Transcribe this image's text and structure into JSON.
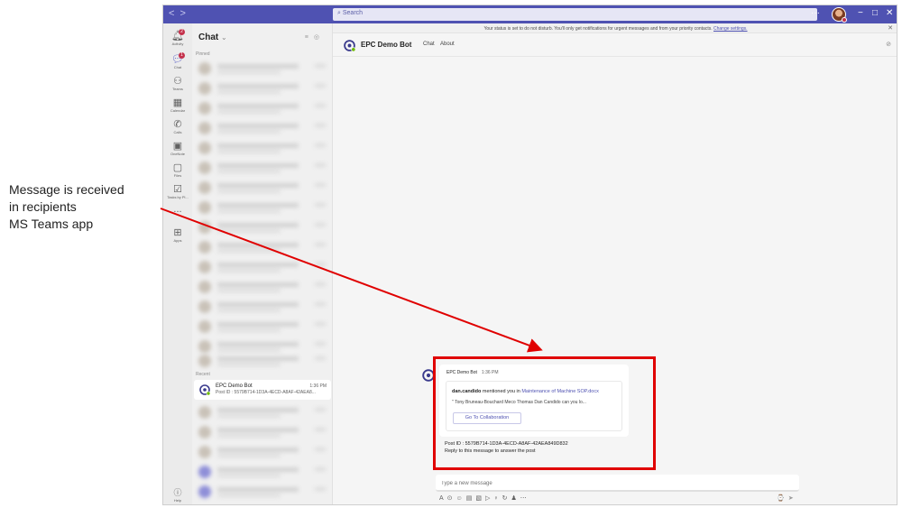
{
  "annotation": {
    "lines": [
      "Message is received",
      "in recipients",
      "MS Teams app"
    ],
    "color": "#e00000"
  },
  "titlebar": {
    "search_placeholder": "Search",
    "nav_back": "<",
    "nav_forward": ">",
    "more": "···",
    "minimize": "−",
    "maximize": "□",
    "close": "✕"
  },
  "rail": {
    "items": [
      {
        "label": "Activity",
        "icon": "bell-icon",
        "badge": "2"
      },
      {
        "label": "Chat",
        "icon": "chat-icon",
        "badge": "1"
      },
      {
        "label": "Teams",
        "icon": "teams-icon"
      },
      {
        "label": "Calendar",
        "icon": "calendar-icon"
      },
      {
        "label": "Calls",
        "icon": "phone-icon"
      },
      {
        "label": "OneNote",
        "icon": "onenote-icon"
      },
      {
        "label": "Files",
        "icon": "file-icon"
      },
      {
        "label": "Tasks by Pl...",
        "icon": "tasks-icon"
      },
      {
        "label": "...",
        "icon": "more-icon"
      },
      {
        "label": "Apps",
        "icon": "apps-icon"
      }
    ],
    "help_label": "Help"
  },
  "chatlist": {
    "title": "Chat",
    "pinned_label": "Pinned",
    "recent_label": "Recent",
    "bot_item": {
      "name": "EPC Demo Bot",
      "preview": "Post ID : 5579B714-1D3A-4ECD-A8AF-42AEA8...",
      "time": "1:36 PM"
    }
  },
  "main": {
    "status_banner": "Your status is set to do not disturb. You'll only get notifications for urgent messages and from your priority contacts.",
    "status_link": "Change settings.",
    "header_title": "EPC Demo Bot",
    "tab_chat": "Chat",
    "tab_about": "About"
  },
  "message": {
    "sender": "EPC Demo Bot",
    "time": "1:36 PM",
    "mention_user": "dan.candido",
    "mention_text": "mentioned you in",
    "doc_link": "Maintenance of Machine SOP.docx",
    "quote": "\" Tony Bruneau-Bouchard Meco Thomas Dan Candido  can you lo...",
    "button_label": "Go To Collaboration",
    "post_id": "Post ID : 5579B714-1D3A-4ECD-A8AF-42AEA849D832",
    "reply_hint": "Reply to this message to answer the post"
  },
  "compose": {
    "placeholder": "Type a new message"
  },
  "colors": {
    "brand": "#4f52b2",
    "highlight": "#e00000",
    "badge": "#c4314b"
  }
}
